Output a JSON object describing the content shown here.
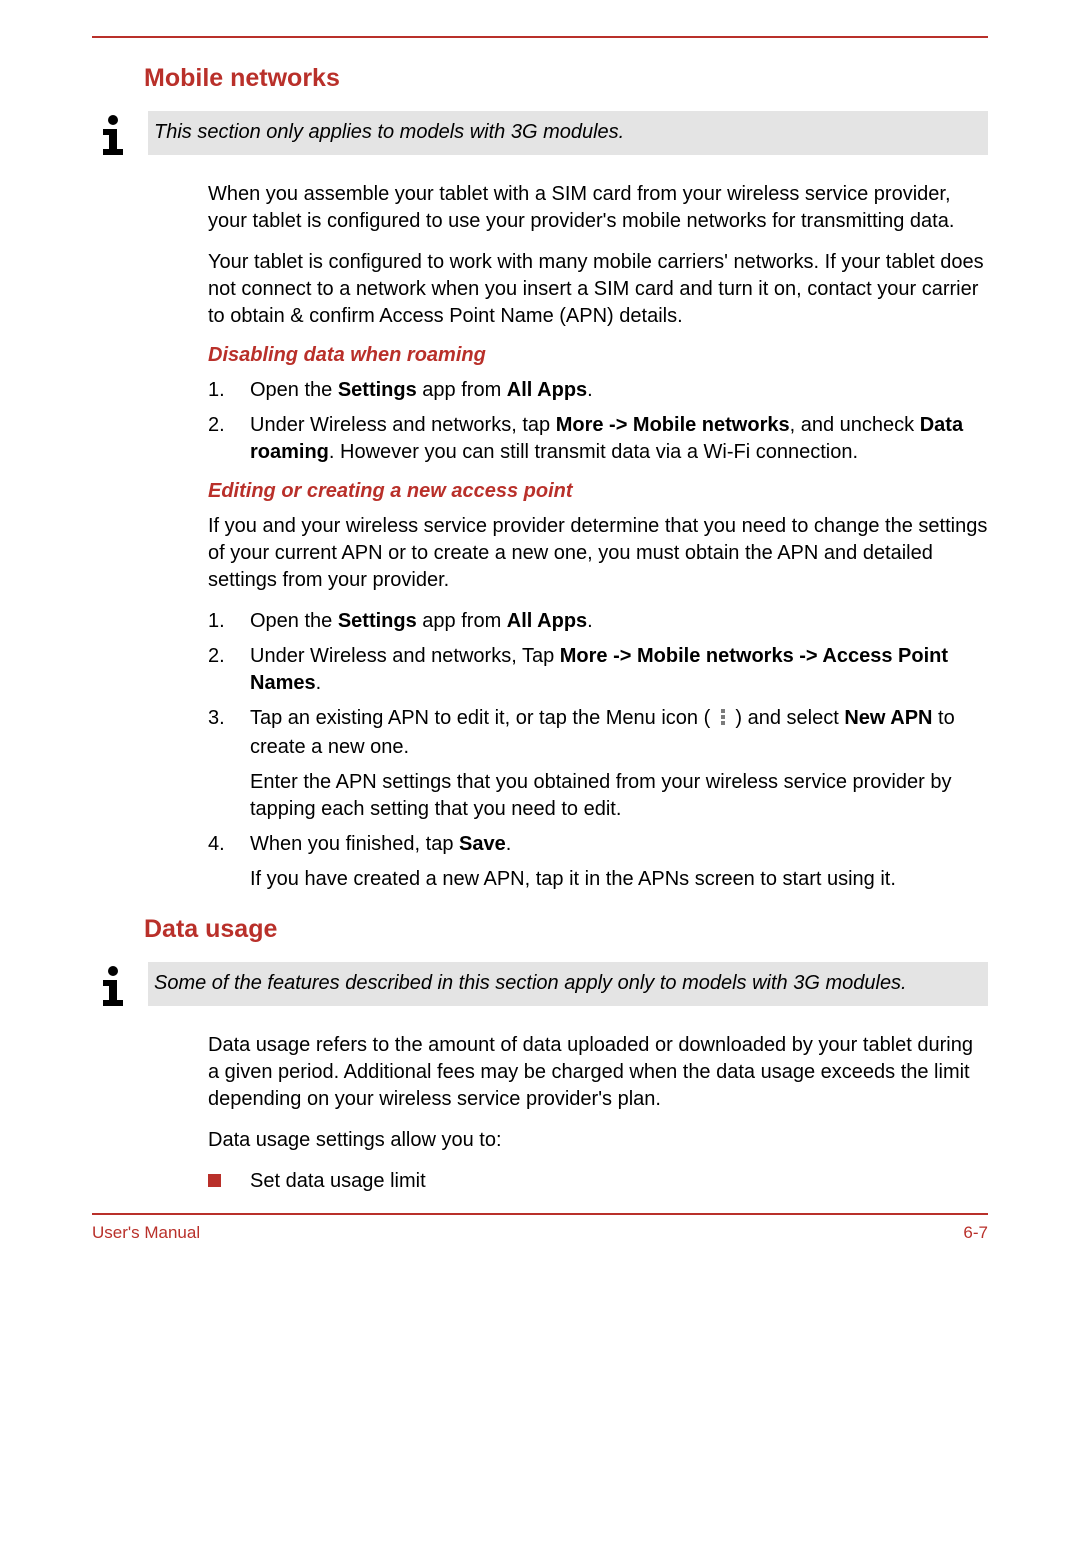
{
  "sections": {
    "mobile_networks": {
      "heading": "Mobile networks",
      "note": "This section only applies to models with 3G modules.",
      "para1": "When you assemble your tablet with a SIM card from your wireless service provider, your tablet is configured to use your provider's mobile networks for transmitting data.",
      "para2": "Your tablet is configured to work with many mobile carriers' networks. If your tablet does not connect to a network when you insert a SIM card and turn it on, contact your carrier to obtain & confirm Access Point Name (APN) details.",
      "sub_roaming": {
        "heading": "Disabling data when roaming",
        "step1_a": "Open the ",
        "step1_b": "Settings",
        "step1_c": " app from ",
        "step1_d": "All Apps",
        "step1_e": ".",
        "step2_a": "Under Wireless and networks, tap ",
        "step2_b": "More -> Mobile networks",
        "step2_c": ", and uncheck ",
        "step2_d": "Data roaming",
        "step2_e": ". However you can still transmit data via a Wi-Fi connection."
      },
      "sub_apn": {
        "heading": "Editing or creating a new access point",
        "intro": "If you and your wireless service provider determine that you need to change the settings of your current APN or to create a new one, you must obtain the APN and detailed settings from your provider.",
        "step1_a": "Open the ",
        "step1_b": "Settings",
        "step1_c": " app from ",
        "step1_d": "All Apps",
        "step1_e": ".",
        "step2_a": "Under Wireless and networks, Tap ",
        "step2_b": "More -> Mobile networks -> Access Point Names",
        "step2_c": ".",
        "step3_a": "Tap an existing APN to edit it, or tap the Menu icon ( ",
        "step3_b": " ) and select ",
        "step3_c": "New APN",
        "step3_d": " to create a new one.",
        "step3_p": "Enter the APN settings that you obtained from your wireless service provider by tapping each setting that you need to edit.",
        "step4_a": "When you finished, tap ",
        "step4_b": "Save",
        "step4_c": ".",
        "step4_p": "If you have created a new APN, tap it in the APNs screen to start using it."
      }
    },
    "data_usage": {
      "heading": "Data usage",
      "note": "Some of the features described in this section apply only to models with 3G modules.",
      "para1": "Data usage refers to the amount of data uploaded or downloaded by your tablet during a given period. Additional fees may be charged when the data usage exceeds the limit depending on your wireless service provider's plan.",
      "para2": "Data usage settings allow you to:",
      "bullet1": "Set data usage limit"
    }
  },
  "footer": {
    "left": "User's Manual",
    "right": "6-7"
  }
}
